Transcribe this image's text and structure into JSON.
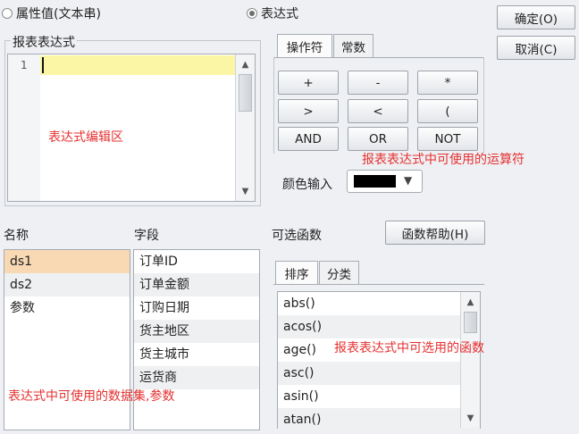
{
  "mode": {
    "option_text": "属性值(文本串)",
    "option_expr": "表达式"
  },
  "dialog_buttons": {
    "ok": "确定(O)",
    "cancel": "取消(C)"
  },
  "editor": {
    "group_title": "报表表达式",
    "line_number": "1",
    "annotation": "表达式编辑区"
  },
  "operator_tabs": [
    "操作符",
    "常数"
  ],
  "operators": [
    "+",
    "-",
    "*",
    ">",
    "<",
    "(",
    "AND",
    "OR",
    "NOT"
  ],
  "operator_annotation": "报表表达式中可使用的运算符",
  "color_input": {
    "label": "颜色输入",
    "value_color": "#000000"
  },
  "names": {
    "header": "名称",
    "items": [
      "ds1",
      "ds2",
      "参数"
    ],
    "selected_index": 0
  },
  "fields": {
    "header": "字段",
    "items": [
      "订单ID",
      "订单金额",
      "订购日期",
      "货主地区",
      "货主城市",
      "运货商"
    ]
  },
  "names_annotation": "表达式中可使用的数据集,参数",
  "functions": {
    "header": "可选函数",
    "help_button": "函数帮助(H)",
    "tabs": [
      "排序",
      "分类"
    ],
    "items": [
      "abs()",
      "acos()",
      "age()",
      "asc()",
      "asin()",
      "atan()"
    ],
    "annotation": "报表表达式中可选用的函数"
  }
}
